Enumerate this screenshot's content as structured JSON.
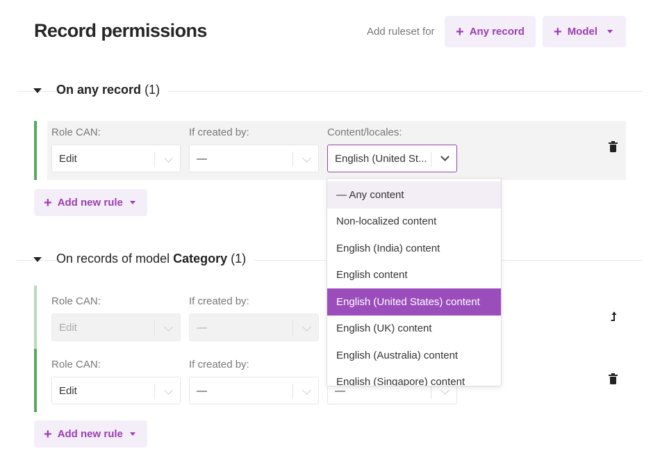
{
  "header": {
    "title": "Record permissions",
    "add_ruleset_label": "Add ruleset for",
    "any_record_button": "Any record",
    "model_button": "Model"
  },
  "sections": [
    {
      "title_prefix": "On any record",
      "title_bold": "",
      "count": "(1)",
      "rules": [
        {
          "role_label": "Role CAN:",
          "role_value": "Edit",
          "created_label": "If created by:",
          "created_value": "—",
          "content_label": "Content/locales:",
          "content_value": "English (United St..."
        }
      ],
      "add_rule_label": "Add new rule"
    },
    {
      "title_prefix": "On records of model ",
      "title_bold": "Category",
      "count": "(1)",
      "rules": [
        {
          "role_label": "Role CAN:",
          "role_value": "Edit",
          "created_label": "If created by:",
          "created_value": "—"
        },
        {
          "role_label": "Role CAN:",
          "role_value": "Edit",
          "created_label": "If created by:",
          "created_value": "—",
          "content_value": "—"
        }
      ],
      "add_rule_label": "Add new rule"
    }
  ],
  "dropdown": {
    "options": [
      "— Any content",
      "Non-localized content",
      "English (India) content",
      "English content",
      "English (United States) content",
      "English (UK) content",
      "English (Australia) content",
      "English (Singapore) content"
    ],
    "selected": "English (United States) content"
  },
  "icons": {
    "trash": "trash-icon",
    "move": "move-up-icon",
    "plus": "plus-icon",
    "caret": "caret-down-icon",
    "chevron": "chevron-down-icon"
  },
  "colors": {
    "accent": "#9b3fb0",
    "accent_bg": "#f3eef8",
    "selected_option": "#9b4dbc",
    "rule_bar": "#5ba65f"
  }
}
